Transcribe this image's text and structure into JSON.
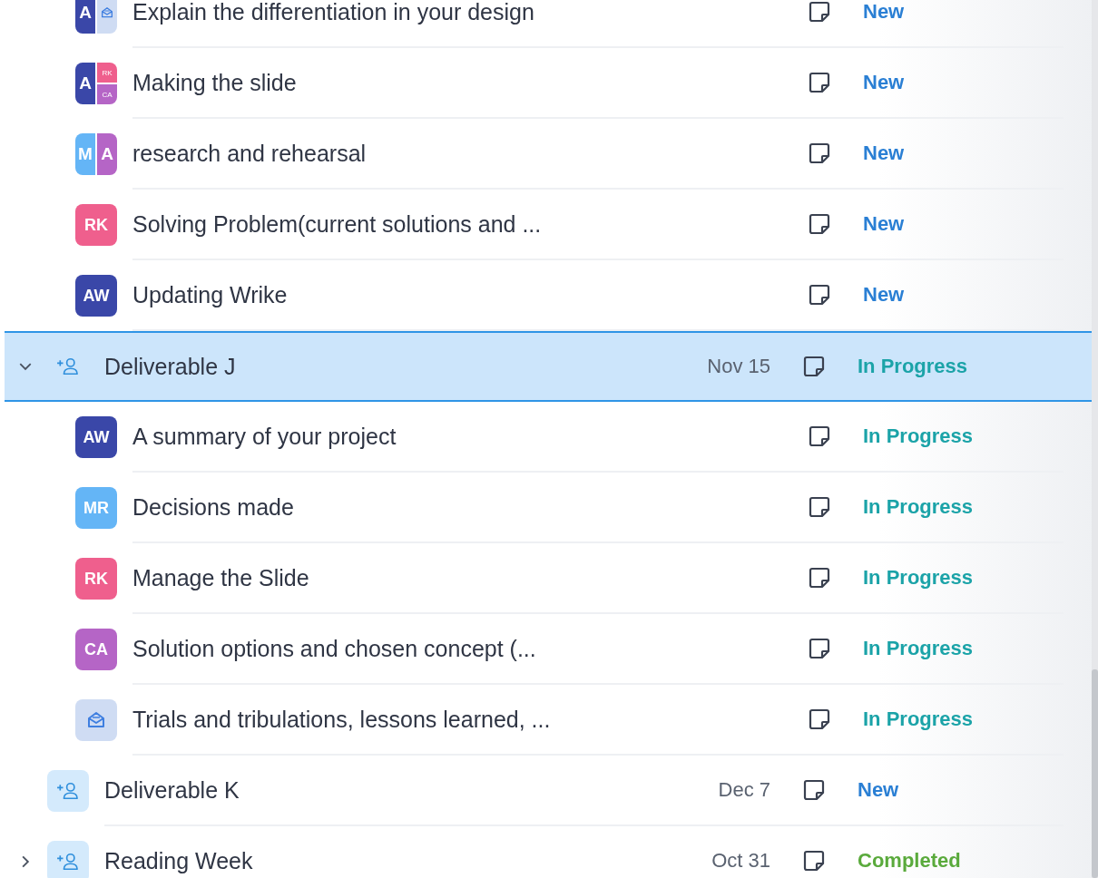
{
  "rows": [
    {
      "kind": "task",
      "title": "Explain the differentiation in your design",
      "status": "New",
      "color": "#2a7fd4",
      "avatar": [
        {
          "kind": "initials",
          "initials": "A",
          "color": "#3a47a8"
        },
        {
          "kind": "icon",
          "color": "#cfdcf3"
        }
      ]
    },
    {
      "kind": "task",
      "title": "Making the slide",
      "status": "New",
      "color": "#2a7fd4",
      "avatar": [
        {
          "kind": "initials",
          "initials": "A",
          "color": "#3a47a8"
        },
        {
          "kind": "initials",
          "initials": "RK",
          "color": "#ef5f8d"
        },
        {
          "kind": "initials",
          "initials": "CA",
          "color": "#b565c6"
        }
      ]
    },
    {
      "kind": "task",
      "title": "research and rehearsal",
      "status": "New",
      "color": "#2a7fd4",
      "avatar": [
        {
          "kind": "initials",
          "initials": "M",
          "color": "#64b5f6"
        },
        {
          "kind": "initials",
          "initials": "A",
          "color": "#b565c6"
        }
      ]
    },
    {
      "kind": "task",
      "title": "Solving Problem(current solutions and ...",
      "status": "New",
      "color": "#2a7fd4",
      "avatar": [
        {
          "kind": "initials",
          "initials": "RK",
          "color": "#ef5f8d"
        }
      ]
    },
    {
      "kind": "task",
      "title": "Updating Wrike",
      "status": "New",
      "color": "#2a7fd4",
      "avatar": [
        {
          "kind": "initials",
          "initials": "AW",
          "color": "#3a47a8"
        }
      ]
    },
    {
      "kind": "group",
      "title": "Deliverable J",
      "date": "Nov 15",
      "status": "In Progress",
      "color": "#1ba3a8",
      "expanded": true,
      "selected": true
    },
    {
      "kind": "task",
      "title": "A summary of your project",
      "status": "In Progress",
      "color": "#1ba3a8",
      "avatar": [
        {
          "kind": "initials",
          "initials": "AW",
          "color": "#3a47a8"
        }
      ]
    },
    {
      "kind": "task",
      "title": "Decisions made",
      "status": "In Progress",
      "color": "#1ba3a8",
      "avatar": [
        {
          "kind": "initials",
          "initials": "MR",
          "color": "#64b5f6"
        }
      ]
    },
    {
      "kind": "task",
      "title": "Manage the Slide",
      "status": "In Progress",
      "color": "#1ba3a8",
      "avatar": [
        {
          "kind": "initials",
          "initials": "RK",
          "color": "#ef5f8d"
        }
      ]
    },
    {
      "kind": "task",
      "title": "Solution options and chosen concept (...",
      "status": "In Progress",
      "color": "#1ba3a8",
      "avatar": [
        {
          "kind": "initials",
          "initials": "CA",
          "color": "#b565c6"
        }
      ]
    },
    {
      "kind": "task",
      "title": "Trials and tribulations, lessons learned, ...",
      "status": "In Progress",
      "color": "#1ba3a8",
      "avatar": [
        {
          "kind": "icon",
          "color": "#cfdcf3"
        }
      ]
    },
    {
      "kind": "group",
      "title": "Deliverable K",
      "date": "Dec 7",
      "status": "New",
      "color": "#2a7fd4",
      "selected": false
    },
    {
      "kind": "group",
      "title": "Reading Week",
      "date": "Oct 31",
      "status": "Completed",
      "color": "#5aaa3c",
      "expanded": false,
      "selected": false
    }
  ]
}
